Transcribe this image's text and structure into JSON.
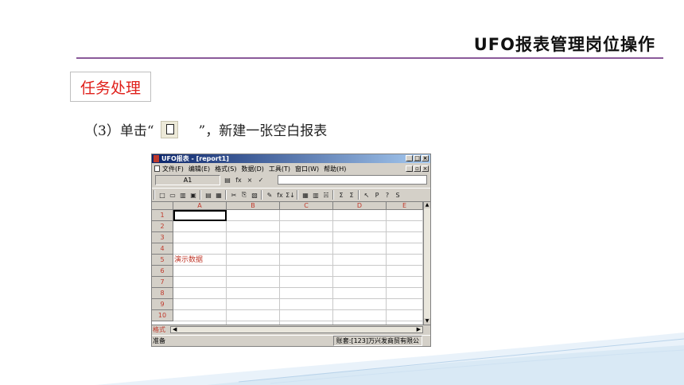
{
  "slide": {
    "title": "UFO报表管理岗位操作",
    "section_label": "任务处理",
    "instruction_prefix": "（3）单击“",
    "instruction_suffix": "”，新建一张空白报表"
  },
  "app": {
    "window_title": "UFO报表 - [report1]",
    "window_buttons": [
      "_",
      "□",
      "×"
    ],
    "mdi_buttons": [
      "_",
      "▫",
      "×"
    ],
    "menu": [
      "文件(F)",
      "编辑(E)",
      "格式(S)",
      "数据(D)",
      "工具(T)",
      "窗口(W)",
      "帮助(H)"
    ],
    "cell_ref": "A1",
    "formula_icons": [
      "▤",
      "fx",
      "×",
      "✓"
    ],
    "toolbar_icons": [
      "□",
      "▭",
      "▥",
      "▣",
      "▤",
      "▦",
      "✂",
      "⎘",
      "▧",
      "✎",
      "fx",
      "Σ↓",
      "▦",
      "▥",
      "☵",
      "Σ",
      "Σ",
      "↖",
      "P",
      "?",
      "S"
    ],
    "columns": [
      "A",
      "B",
      "C",
      "D",
      "E"
    ],
    "rows": [
      "1",
      "2",
      "3",
      "4",
      "5",
      "6",
      "7",
      "8",
      "9",
      "10"
    ],
    "demo_cell_text": "演示数据",
    "mode_label": "格式",
    "status_left": "准备",
    "status_right": "账套:[123]万兴发商贸有限公"
  },
  "colors": {
    "accent_red": "#e0201b",
    "rule_purple": "#8a5a9a",
    "titlebar_blue": "#0a246a"
  }
}
